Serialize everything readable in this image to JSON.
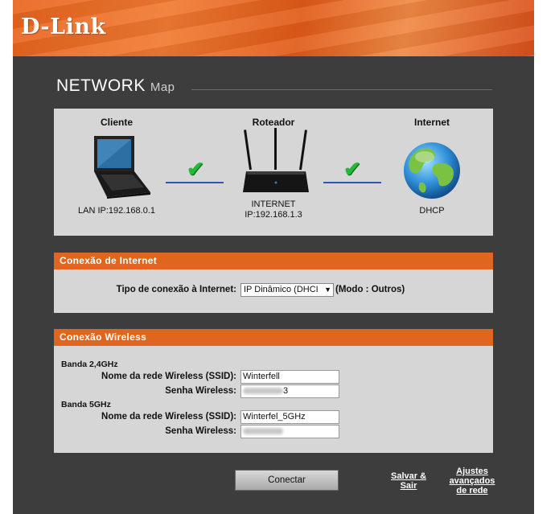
{
  "brand": {
    "logo": "D-Link"
  },
  "page": {
    "title": "NETWORK",
    "title_suffix": "Map"
  },
  "network_map": {
    "client": {
      "label": "Cliente",
      "info": "LAN IP:192.168.0.1"
    },
    "router": {
      "label": "Roteador",
      "info_line1": "INTERNET",
      "info_line2": "IP:192.168.1.3"
    },
    "internet": {
      "label": "Internet",
      "info": "DHCP"
    },
    "links": [
      "connected",
      "connected"
    ]
  },
  "internet_section": {
    "header": "Conexão de Internet",
    "type_label": "Tipo de conexão à Internet:",
    "type_value": "IP Dinâmico (DHCI",
    "mode": "(Modo : Outros)"
  },
  "wireless_section": {
    "header": "Conexão Wireless",
    "band24": {
      "label": "Banda 2,4GHz",
      "ssid_label": "Nome da rede Wireless (SSID):",
      "ssid_value": "Winterfell",
      "password_label": "Senha Wireless:",
      "password_visible_suffix": "3"
    },
    "band5": {
      "label": "Banda 5GHz",
      "ssid_label": "Nome da rede Wireless (SSID):",
      "ssid_value": "Winterfel_5GHz",
      "password_label": "Senha Wireless:"
    }
  },
  "actions": {
    "connect": "Conectar",
    "save_exit_line1": "Salvar &",
    "save_exit_line2": "Sair",
    "advanced_line1": "Ajustes",
    "advanced_line2": "avançados",
    "advanced_line3": "de rede"
  },
  "colors": {
    "accent": "#e0651f",
    "background": "#3d3d3d",
    "panel": "#d6d6d6",
    "check": "#22b83a"
  }
}
